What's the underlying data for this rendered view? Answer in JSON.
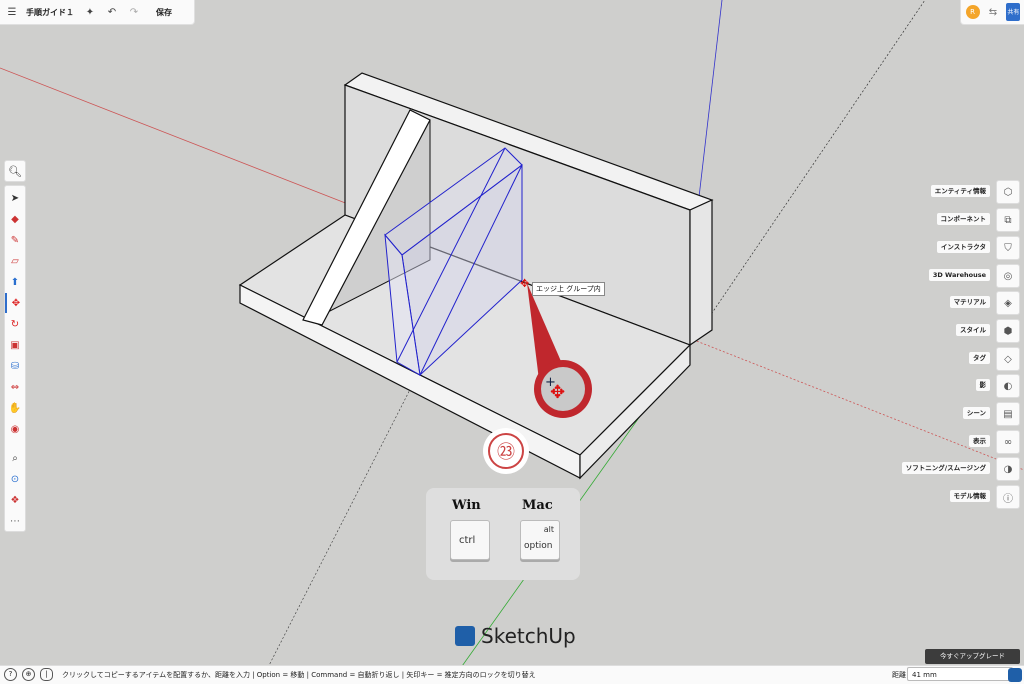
{
  "topbar": {
    "title": "手順ガイド１",
    "save_label": "保存"
  },
  "topright": {
    "avatar_text": "R",
    "share_text": "共有"
  },
  "icons": {
    "tools": [
      "select-icon",
      "eraser-icon",
      "pencil-icon",
      "rectangle-icon",
      "push-pull-icon",
      "move-icon",
      "rotate-icon",
      "offset-icon",
      "paint-bucket-icon",
      "scale-icon",
      "follow-me-icon",
      "tape-measure-icon",
      "zoom-icon",
      "orbit-icon",
      "walk-icon",
      "more-icon"
    ]
  },
  "right_panel": {
    "items": [
      {
        "label": "エンティティ情報",
        "icon": "entity-info-icon"
      },
      {
        "label": "コンポーネント",
        "icon": "components-icon"
      },
      {
        "label": "インストラクタ",
        "icon": "instructor-icon"
      },
      {
        "label": "3D Warehouse",
        "icon": "warehouse-icon"
      },
      {
        "label": "マテリアル",
        "icon": "materials-icon"
      },
      {
        "label": "スタイル",
        "icon": "styles-icon"
      },
      {
        "label": "タグ",
        "icon": "tags-icon"
      },
      {
        "label": "影",
        "icon": "shadows-icon"
      },
      {
        "label": "シーン",
        "icon": "scenes-icon"
      },
      {
        "label": "表示",
        "icon": "display-icon"
      },
      {
        "label": "ソフトニング/スムージング",
        "icon": "soften-icon"
      },
      {
        "label": "モデル情報",
        "icon": "model-info-icon"
      }
    ]
  },
  "viewport": {
    "tooltip": "エッジ上 グループ内",
    "badge_number": "㉓",
    "keys": {
      "win_label": "Win",
      "mac_label": "Mac",
      "win_key": "ctrl",
      "mac_key_top": "alt",
      "mac_key_bottom": "option"
    },
    "logo_text": "SketchUp"
  },
  "statusbar": {
    "hint": "クリックしてコピーするアイテムを配置するか、距離を入力 | Option = 移動 | Command = 自動折り返し | 矢印キー = 推定方向のロックを切り替え",
    "upgrade_label": "今すぐアップグレード",
    "distance_label": "距離",
    "distance_value": "41 mm"
  }
}
